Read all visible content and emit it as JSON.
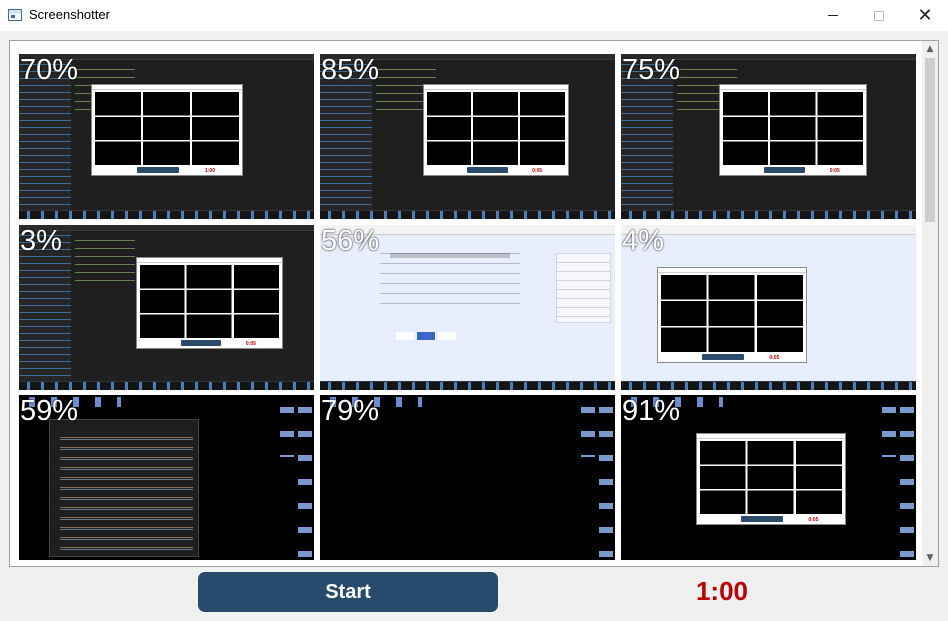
{
  "window": {
    "title": "Screenshotter",
    "icon": "app-window-icon",
    "controls": {
      "minimize": "minimize-icon",
      "maximize": "maximize-icon",
      "close": "close-icon",
      "close_glyph": "✕"
    }
  },
  "thumbnails": [
    {
      "percent": "70%",
      "kind": "ide",
      "mini_time": "1:00"
    },
    {
      "percent": "85%",
      "kind": "ide",
      "mini_time": "0:05"
    },
    {
      "percent": "75%",
      "kind": "ide",
      "mini_time": "0:05"
    },
    {
      "percent": "3%",
      "kind": "ide",
      "mini_time": "0:05"
    },
    {
      "percent": "56%",
      "kind": "browser"
    },
    {
      "percent": "4%",
      "kind": "browser",
      "mini_time": "0:05"
    },
    {
      "percent": "59%",
      "kind": "desktop-editor"
    },
    {
      "percent": "79%",
      "kind": "desktop"
    },
    {
      "percent": "91%",
      "kind": "desktop-app",
      "mini_time": "0:05"
    }
  ],
  "scrollbar": {
    "up_glyph": "▲",
    "down_glyph": "▼"
  },
  "controls": {
    "start_label": "Start",
    "timer": "1:00"
  },
  "colors": {
    "start_button": "#284a6d",
    "timer": "#c00000"
  }
}
